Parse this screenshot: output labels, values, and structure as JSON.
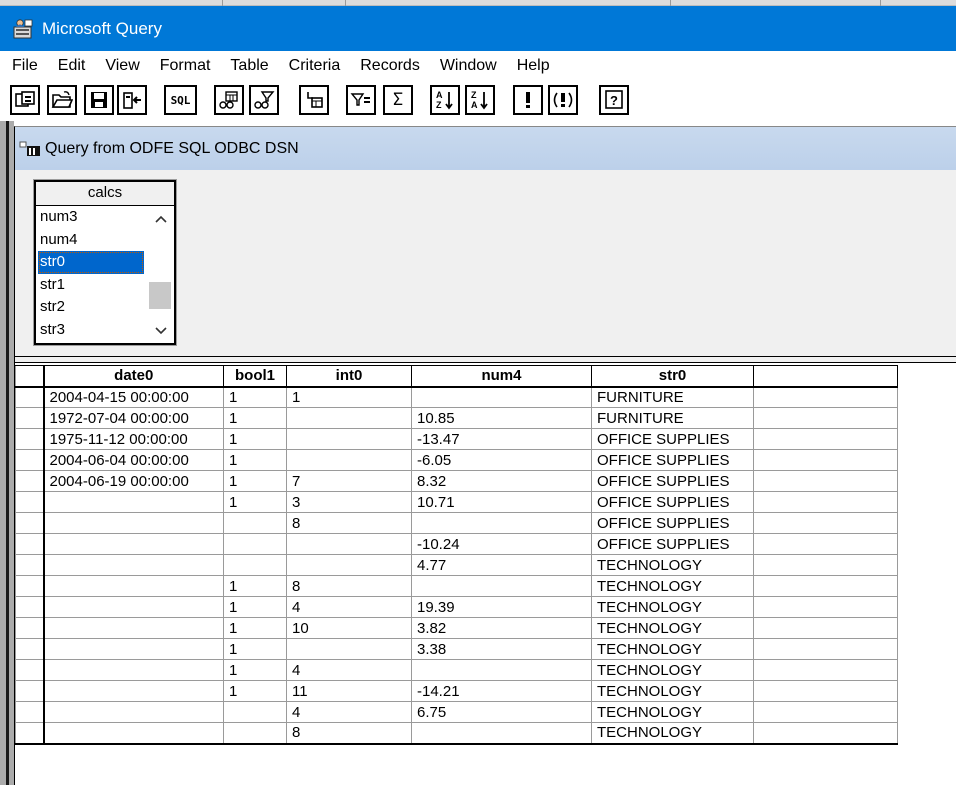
{
  "window": {
    "title": "Microsoft Query"
  },
  "menu": [
    "File",
    "Edit",
    "View",
    "Format",
    "Table",
    "Criteria",
    "Records",
    "Window",
    "Help"
  ],
  "toolbar": {
    "sql_label": "SQL",
    "sigma_label": "Σ"
  },
  "query_window": {
    "title": "Query from ODFE SQL ODBC DSN"
  },
  "table_box": {
    "name": "calcs",
    "fields": [
      "num3",
      "num4",
      "str0",
      "str1",
      "str2",
      "str3"
    ],
    "selected_index": 2
  },
  "grid": {
    "columns": [
      "date0",
      "bool1",
      "int0",
      "num4",
      "str0",
      ""
    ],
    "rows": [
      [
        "2004-04-15 00:00:00",
        "1",
        "1",
        "",
        "FURNITURE",
        ""
      ],
      [
        "1972-07-04 00:00:00",
        "1",
        "",
        "10.85",
        "FURNITURE",
        ""
      ],
      [
        "1975-11-12 00:00:00",
        "1",
        "",
        "-13.47",
        "OFFICE SUPPLIES",
        ""
      ],
      [
        "2004-06-04 00:00:00",
        "1",
        "",
        "-6.05",
        "OFFICE SUPPLIES",
        ""
      ],
      [
        "2004-06-19 00:00:00",
        "1",
        "7",
        "8.32",
        "OFFICE SUPPLIES",
        ""
      ],
      [
        "",
        "1",
        "3",
        "10.71",
        "OFFICE SUPPLIES",
        ""
      ],
      [
        "",
        "",
        "8",
        "",
        "OFFICE SUPPLIES",
        ""
      ],
      [
        "",
        "",
        "",
        "-10.24",
        "OFFICE SUPPLIES",
        ""
      ],
      [
        "",
        "",
        "",
        "4.77",
        "TECHNOLOGY",
        ""
      ],
      [
        "",
        "1",
        "8",
        "",
        "TECHNOLOGY",
        ""
      ],
      [
        "",
        "1",
        "4",
        "19.39",
        "TECHNOLOGY",
        ""
      ],
      [
        "",
        "1",
        "10",
        "3.82",
        "TECHNOLOGY",
        ""
      ],
      [
        "",
        "1",
        "",
        "3.38",
        "TECHNOLOGY",
        ""
      ],
      [
        "",
        "1",
        "4",
        "",
        "TECHNOLOGY",
        ""
      ],
      [
        "",
        "1",
        "11",
        "-14.21",
        "TECHNOLOGY",
        ""
      ],
      [
        "",
        "",
        "4",
        "6.75",
        "TECHNOLOGY",
        ""
      ],
      [
        "",
        "",
        "8",
        "",
        "TECHNOLOGY",
        ""
      ]
    ]
  },
  "colors": {
    "titlebar": "#0078d7",
    "child_titlebar": "#c8d9ee",
    "selection": "#0066cc"
  }
}
